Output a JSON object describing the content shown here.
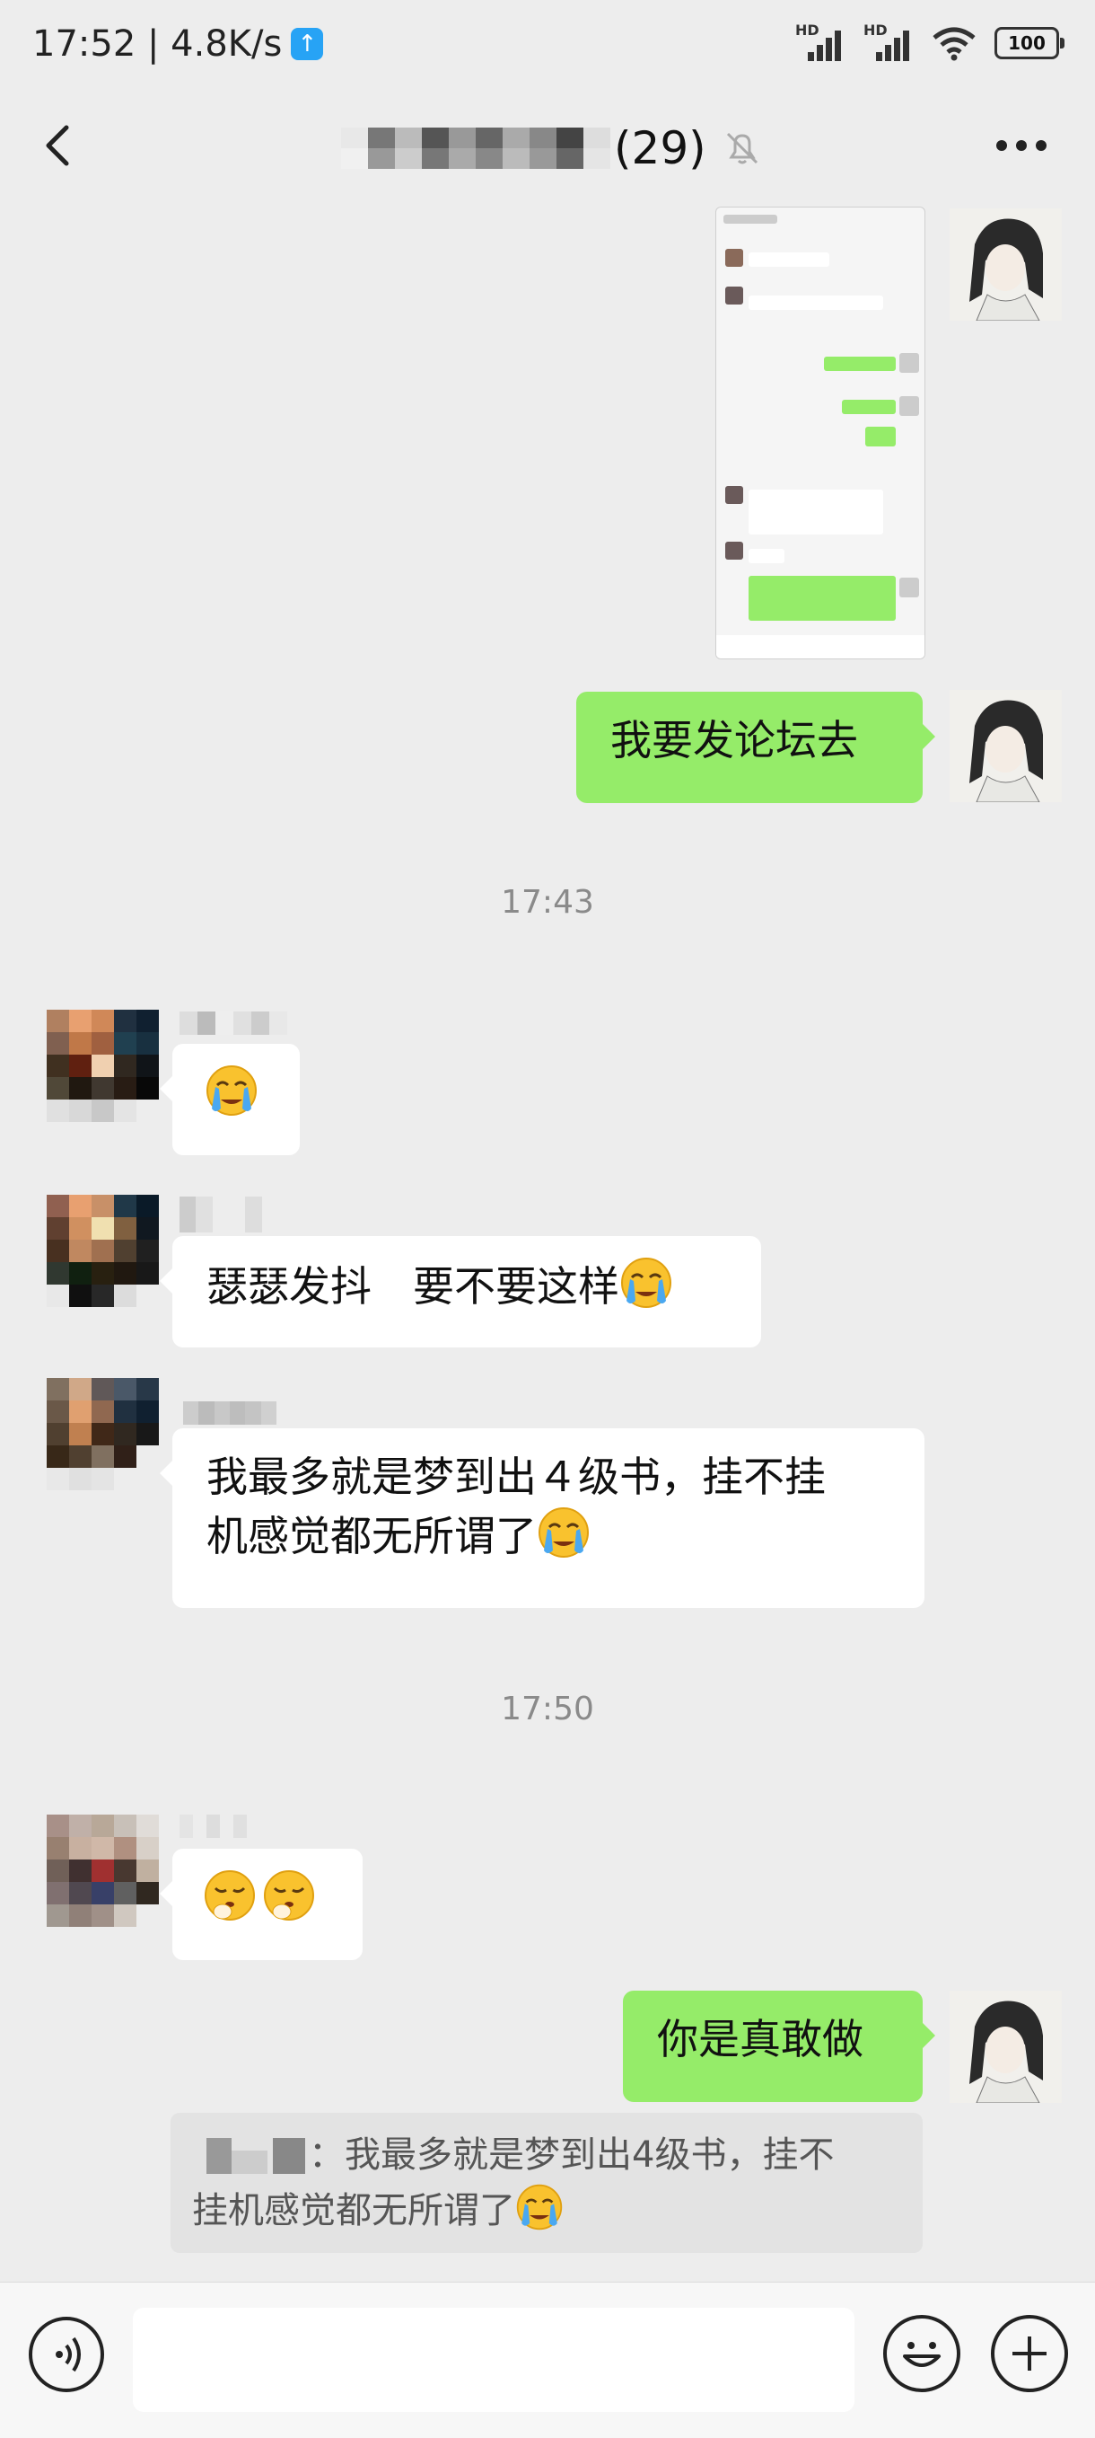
{
  "status_bar": {
    "time_speed": "17:52 | 4.8K/s",
    "upload_icon": "up-arrow-icon",
    "signal_1_label": "HD",
    "signal_2_label": "HD",
    "battery": "100"
  },
  "header": {
    "back_icon": "chevron-left-icon",
    "member_count": "(29)",
    "mute_icon": "bell-off-icon",
    "more_icon": "more-dots-icon"
  },
  "messages": {
    "m1_text": "我要发论坛去",
    "time_1": "17:43",
    "m3_text": "瑟瑟发抖　要不要这样",
    "m4_text_line1": "我最多就是梦到出４级书，挂不挂",
    "m4_text_line2": "机感觉都无所谓了",
    "time_2": "17:50",
    "m6_text": "你是真敢做",
    "quote_text_line1": "：我最多就是梦到出4级书，挂不",
    "quote_text_line2": "挂机感觉都无所谓了"
  },
  "input_bar": {
    "voice_icon": "voice-icon",
    "emoji_icon": "smiley-icon",
    "plus_icon": "plus-icon"
  },
  "colors": {
    "background": "#ededed",
    "my_bubble": "#95ec69",
    "other_bubble": "#ffffff",
    "quote_bg": "#e3e3e3"
  }
}
